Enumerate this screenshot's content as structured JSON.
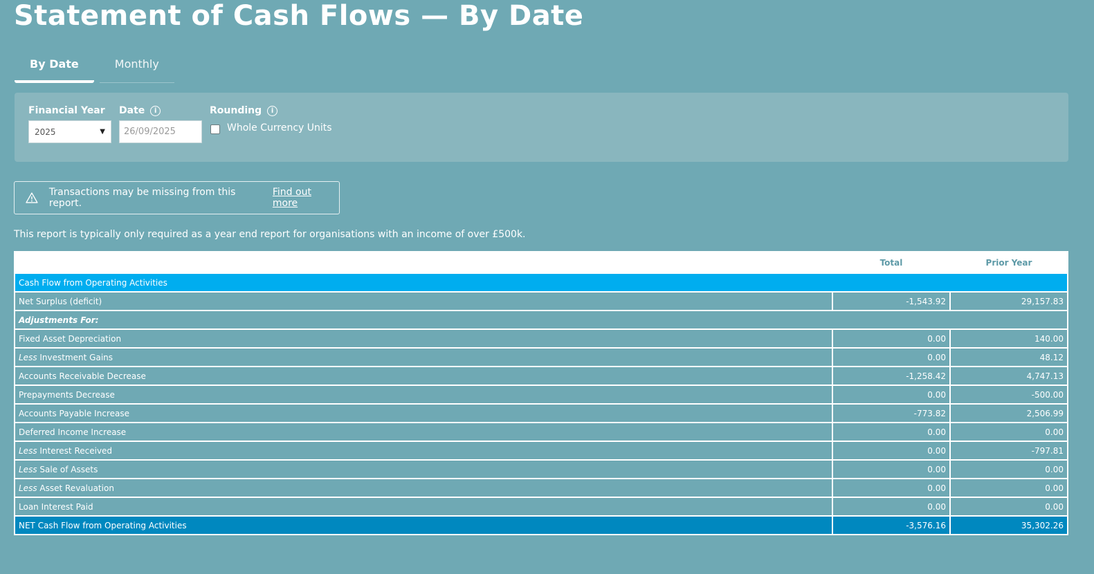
{
  "page": {
    "title": "Statement of Cash Flows — By Date"
  },
  "tabs": [
    {
      "label": "By Date",
      "active": true
    },
    {
      "label": "Monthly",
      "active": false
    }
  ],
  "filters": {
    "financial_year": {
      "label": "Financial Year",
      "value": "2025"
    },
    "date": {
      "label": "Date",
      "value": "26/09/2025"
    },
    "rounding": {
      "label": "Rounding",
      "checkbox_label": "Whole Currency Units",
      "checked": false
    }
  },
  "alert": {
    "message": "Transactions may be missing from this report.",
    "link_text": "Find out more"
  },
  "note": "This report is typically only required as a year end report for organisations with an income of over £500k.",
  "table": {
    "headers": [
      "",
      "Total",
      "Prior Year"
    ],
    "section_title": "Cash Flow from Operating Activities",
    "rows": [
      {
        "prefix": "",
        "label": "Net Surplus (deficit)",
        "total": "-1,543.92",
        "prior": "29,157.83"
      },
      {
        "label": "Adjustments For:",
        "subheading": true
      },
      {
        "prefix": "",
        "label": "Fixed Asset Depreciation",
        "total": "0.00",
        "prior": "140.00"
      },
      {
        "prefix": "Less",
        "label": "Investment Gains",
        "total": "0.00",
        "prior": "48.12"
      },
      {
        "prefix": "",
        "label": "Accounts Receivable Decrease",
        "total": "-1,258.42",
        "prior": "4,747.13"
      },
      {
        "prefix": "",
        "label": "Prepayments Decrease",
        "total": "0.00",
        "prior": "-500.00"
      },
      {
        "prefix": "",
        "label": "Accounts Payable Increase",
        "total": "-773.82",
        "prior": "2,506.99"
      },
      {
        "prefix": "",
        "label": "Deferred Income Increase",
        "total": "0.00",
        "prior": "0.00"
      },
      {
        "prefix": "Less",
        "label": "Interest Received",
        "total": "0.00",
        "prior": "-797.81"
      },
      {
        "prefix": "Less",
        "label": "Sale of Assets",
        "total": "0.00",
        "prior": "0.00"
      },
      {
        "prefix": "Less",
        "label": "Asset Revaluation",
        "total": "0.00",
        "prior": "0.00"
      },
      {
        "prefix": "",
        "label": "Loan Interest Paid",
        "total": "0.00",
        "prior": "0.00"
      }
    ],
    "total_row": {
      "label": "NET Cash Flow from Operating Activities",
      "total": "-3,576.16",
      "prior": "35,302.26"
    }
  },
  "colors": {
    "background": "#6fa9b4",
    "panel": "#89b6be",
    "section_header": "#00adef",
    "total_row": "#0088bf"
  },
  "icons": {
    "info": "info-circle-icon",
    "warning": "warning-triangle-icon",
    "dropdown": "chevron-down-icon"
  }
}
